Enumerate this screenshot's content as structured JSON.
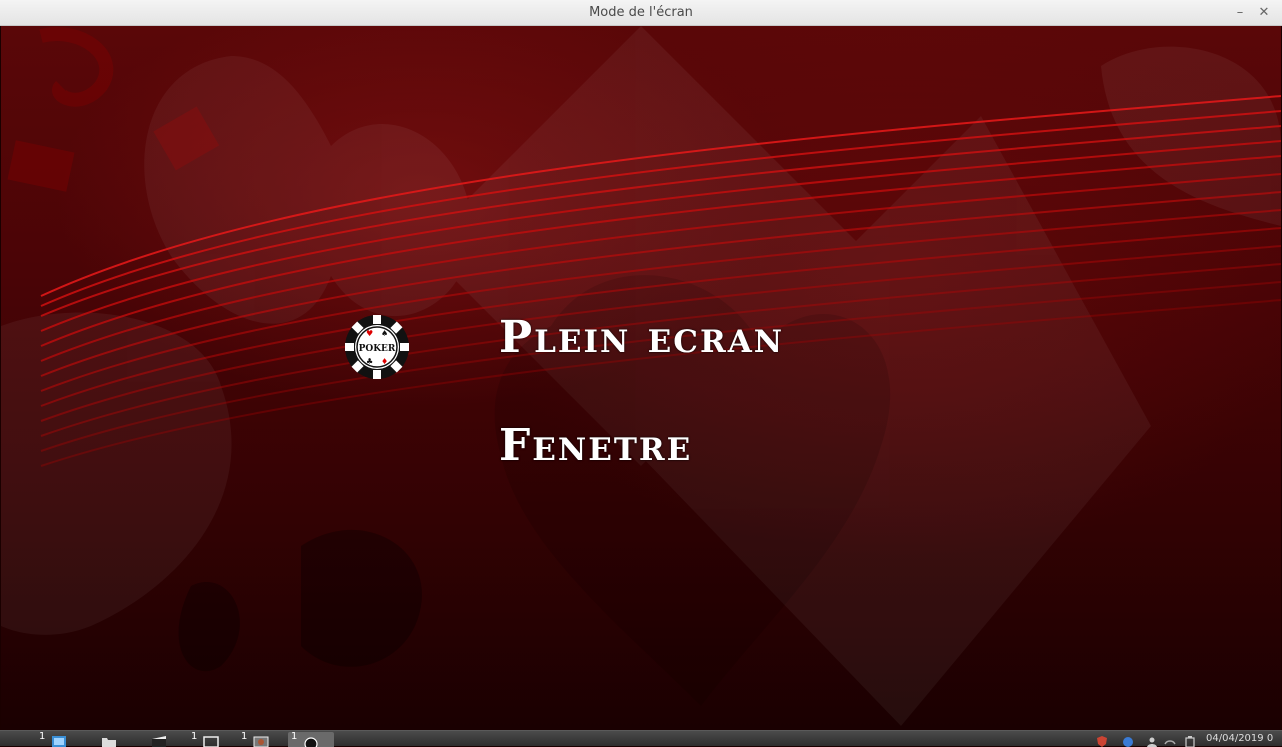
{
  "window": {
    "title": "Mode de l'écran",
    "minimize_glyph": "–",
    "close_glyph": "✕"
  },
  "menu": {
    "items": [
      {
        "label": "Plein ecran",
        "selected": true
      },
      {
        "label": "Fenetre",
        "selected": false
      }
    ],
    "selector_icon": "poker-chip-icon",
    "selector_text": "POKER"
  },
  "taskbar": {
    "tasks": [
      {
        "count": "1",
        "icon": "file-manager-icon",
        "active": false
      },
      {
        "count": "",
        "icon": "folder-icon",
        "active": false
      },
      {
        "count": "",
        "icon": "media-player-icon",
        "active": false
      },
      {
        "count": "1",
        "icon": "terminal-icon",
        "active": false
      },
      {
        "count": "1",
        "icon": "window-icon",
        "active": false
      },
      {
        "count": "1",
        "icon": "poker-app-icon",
        "active": true
      }
    ],
    "clock": "04/04/2019 0"
  },
  "colors": {
    "background": "#4a0406",
    "accent_lines": "#e01010",
    "menu_text": "#ffffff",
    "taskbar": "#3a3a3a"
  }
}
